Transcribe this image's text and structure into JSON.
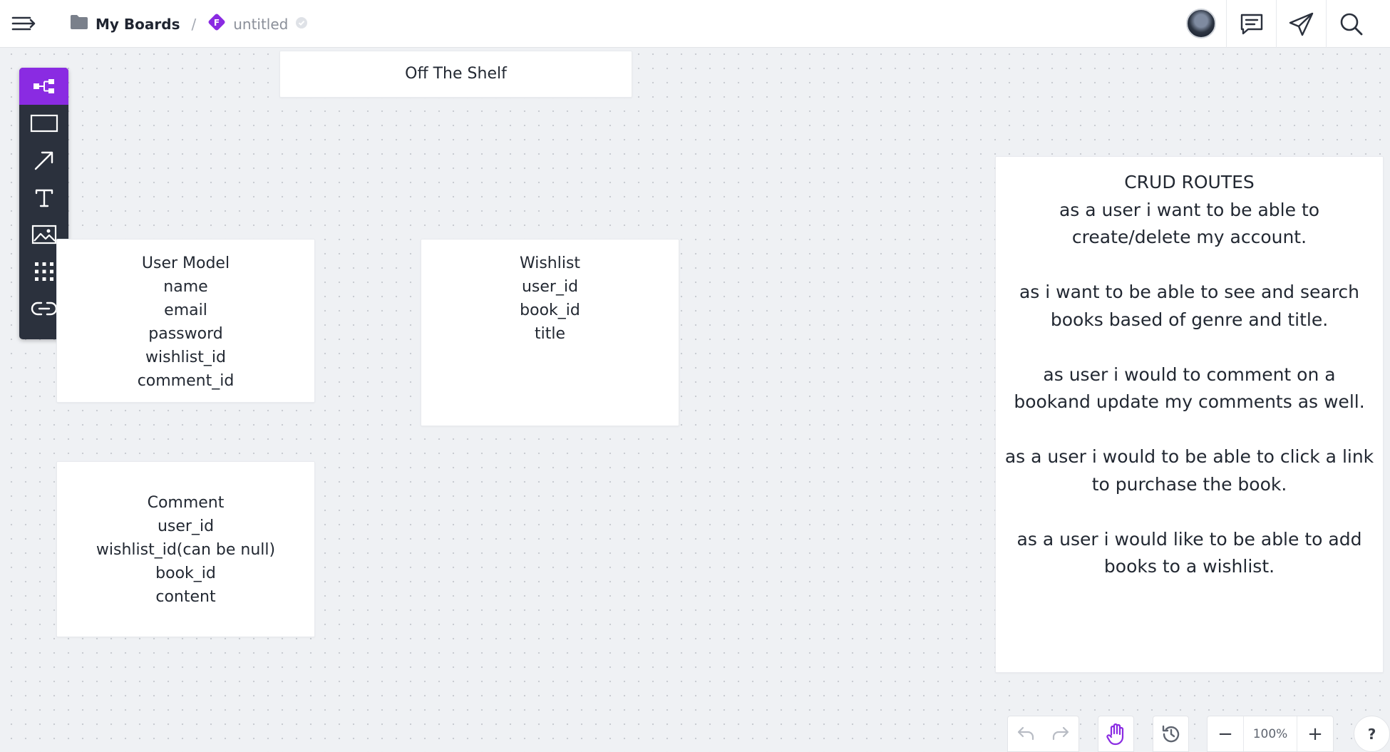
{
  "header": {
    "breadcrumb_board": "My Boards",
    "breadcrumb_separator": "/",
    "file_name": "untitled",
    "file_badge_letter": "F",
    "accent_color": "#8a2be2"
  },
  "toolbar": {
    "tools": [
      {
        "icon": "diagram-icon",
        "active": true
      },
      {
        "icon": "rectangle-icon"
      },
      {
        "icon": "arrow-icon"
      },
      {
        "icon": "text-icon"
      },
      {
        "icon": "image-icon"
      },
      {
        "icon": "grid-apps-icon"
      },
      {
        "icon": "link-icon"
      }
    ]
  },
  "cards": {
    "title": "Off The Shelf",
    "user_model": [
      "User Model",
      "name",
      "email",
      "password",
      "wishlist_id",
      "comment_id"
    ],
    "wishlist": [
      "Wishlist",
      "user_id",
      "book_id",
      "title"
    ],
    "comment": [
      "Comment",
      "user_id",
      "wishlist_id(can be null)",
      "book_id",
      "content"
    ],
    "crud": {
      "heading": "CRUD ROUTES",
      "p1": [
        "as a user i want to be able to",
        "create/delete my account."
      ],
      "p2": [
        "as i want to be able to see and search",
        "books based of genre and title."
      ],
      "p3": [
        "as user i would to comment on a",
        "bookand update my comments as well."
      ],
      "p4": [
        "as a user i would to be able to click a link",
        "to purchase the book."
      ],
      "p5": [
        "as a user i would like to be able to add",
        "books to a wishlist."
      ]
    }
  },
  "bottom": {
    "zoom": "100%",
    "zoom_out_label": "−",
    "zoom_in_label": "+",
    "help_label": "?"
  }
}
